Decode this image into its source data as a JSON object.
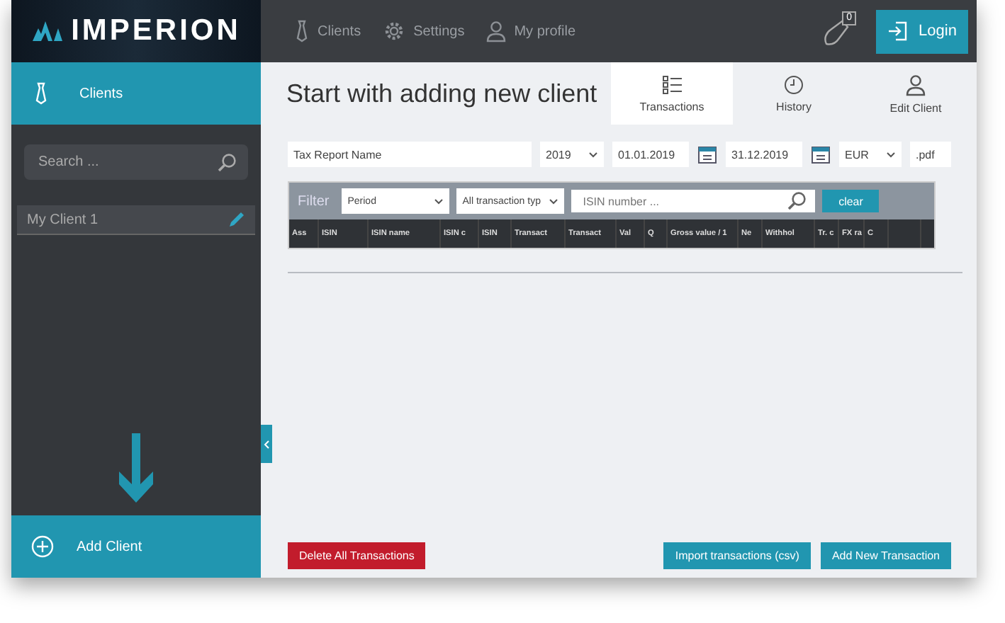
{
  "logo": "IMPERION",
  "sidebar": {
    "header": "Clients",
    "search": {
      "placeholder": "Search ..."
    },
    "clients": [
      {
        "name": "My Client 1"
      }
    ],
    "add_button": "Add Client"
  },
  "nav": [
    {
      "label": "Clients"
    },
    {
      "label": "Settings"
    },
    {
      "label": "My profile"
    }
  ],
  "notifications": {
    "count": "0"
  },
  "login": "Login",
  "title": "Start with adding new client",
  "tabs": [
    {
      "label": "Transactions",
      "selected": true
    },
    {
      "label": "History",
      "selected": false
    },
    {
      "label": "Edit Client",
      "selected": false
    }
  ],
  "report": {
    "name": "Tax Report Name",
    "year": "2019",
    "from": "01.01.2019",
    "to": "31.12.2019",
    "currency": "EUR",
    "format": ".pdf"
  },
  "filter": {
    "label": "Filter",
    "period": "Period",
    "type": "All transaction typ",
    "search": {
      "placeholder": "ISIN number ..."
    },
    "clear": "clear"
  },
  "table": {
    "columns": [
      "Ass",
      "ISIN",
      "ISIN name",
      "ISIN c",
      "ISIN",
      "Transact",
      "Transact",
      "Val",
      "Q",
      "Gross value / 1",
      "Ne",
      "Withhol",
      "Tr. c",
      "FX ra",
      "C",
      ""
    ]
  },
  "buttons": [
    {
      "label": "Delete All Transactions",
      "kind": "danger"
    },
    {
      "label": "Import transactions (csv)",
      "kind": "primary"
    },
    {
      "label": "Add New Transaction",
      "kind": "primary"
    }
  ]
}
